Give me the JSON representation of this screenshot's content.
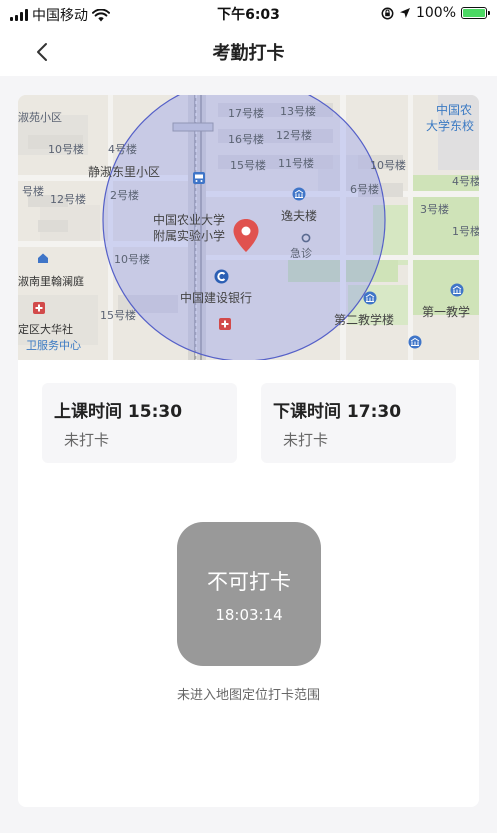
{
  "status_bar": {
    "carrier": "中国移动",
    "time": "下午6:03",
    "battery": "100%"
  },
  "nav": {
    "title": "考勤打卡"
  },
  "map": {
    "labels": {
      "l1": "淑苑小区",
      "l2": "10号楼",
      "l3": "4号楼",
      "l4": "静淑东里小区",
      "l5": "2号楼",
      "l6": "12号楼",
      "l7": "号楼",
      "l8": "10号楼",
      "l9": "淑南里翰澜庭",
      "l10": "15号楼",
      "l11": "定区大华社",
      "l12": "卫服务中心",
      "l13": "17号楼",
      "l14": "13号楼",
      "l15": "16号楼",
      "l16": "12号楼",
      "l17": "15号楼",
      "l18": "11号楼",
      "l19": "10号楼",
      "l20": "6号楼",
      "l21": "中国农业大学",
      "l22": "附属实验小学",
      "l23": "逸夫楼",
      "l24": "急诊",
      "l25": "中国建设银行",
      "l26": "第二教学楼",
      "l27": "第一教学",
      "l28": "中国农",
      "l29": "大学东校",
      "l30": "4号楼",
      "l31": "3号楼",
      "l32": "1号楼"
    }
  },
  "checkin": {
    "start_label": "上课时间 15:30",
    "start_status": "未打卡",
    "end_label": "下课时间 17:30",
    "end_status": "未打卡"
  },
  "punch": {
    "label": "不可打卡",
    "time": "18:03:14",
    "hint": "未进入地图定位打卡范围"
  }
}
